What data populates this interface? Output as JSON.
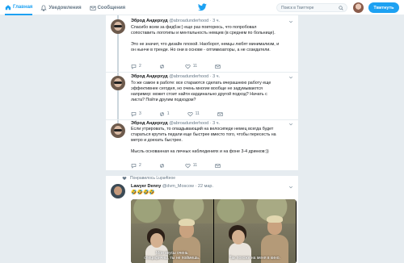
{
  "nav": {
    "home": "Главная",
    "notifications": "Уведомления",
    "messages": "Сообщения"
  },
  "search": {
    "placeholder": "Поиск в Твиттере"
  },
  "tweet_button": "Твитнуть",
  "colors": {
    "accent": "#1da1f2",
    "background": "#e6ecf0",
    "muted": "#657786"
  },
  "thread": [
    {
      "name": "Эброд Андерхуд",
      "handle": "@abroadunderhood · 3 ч.",
      "lines": [
        "Спасибо всем за фидбэк:) еще раз повторюсь, что попробовал",
        "сопоставить логотипы и ментальность немцев (в среднем по больнице).",
        "",
        "Это не значит, что дизайн плохой. Наоборот, немцы любят минимализм, и",
        "он нынче в тренде. Но они в основе - оптимизаторы, а не созидатели."
      ],
      "replies": "2",
      "retweets": "",
      "likes": "11"
    },
    {
      "name": "Эброд Андерхуд",
      "handle": "@abroadunderhood · 3 ч.",
      "lines": [
        "То же самое в работе: все стараются сделать вчерашнюю работу еще",
        "эффективнее сегодня, но очень многие вообще не задумываются",
        "например: может стоит найти кардинально другой подход? Начать с",
        "листа? Пойти другим подходом?"
      ],
      "replies": "3",
      "retweets": "1",
      "likes": "11"
    },
    {
      "name": "Эброд Андерхуд",
      "handle": "@abroadunderhood · 3 ч.",
      "lines": [
        "Если утрировать, то опаздывающий на велосипеде немец всегда будет",
        "стараться крутить педали еще быстрее вместо того, чтобы пересесть на",
        "метро и доехать быстрее.",
        "",
        "Мысль основанная на личных наблюдениях и на фоне 3-4 дринков:))"
      ],
      "replies": "2",
      "retweets": "",
      "likes": "11"
    }
  ],
  "liked_label": "Понравилось Lupa4teoe",
  "quoted": {
    "name": "Lawyer Denny",
    "handle": "@dvm_Moscow · 22 мар.",
    "emoji": "🤣🤣🤣🤣",
    "subtitles": [
      [
        "Мои вкусы очень",
        "специфичны, ты не поймешь."
      ],
      [
        "Так похоже на меня в кино."
      ]
    ]
  }
}
